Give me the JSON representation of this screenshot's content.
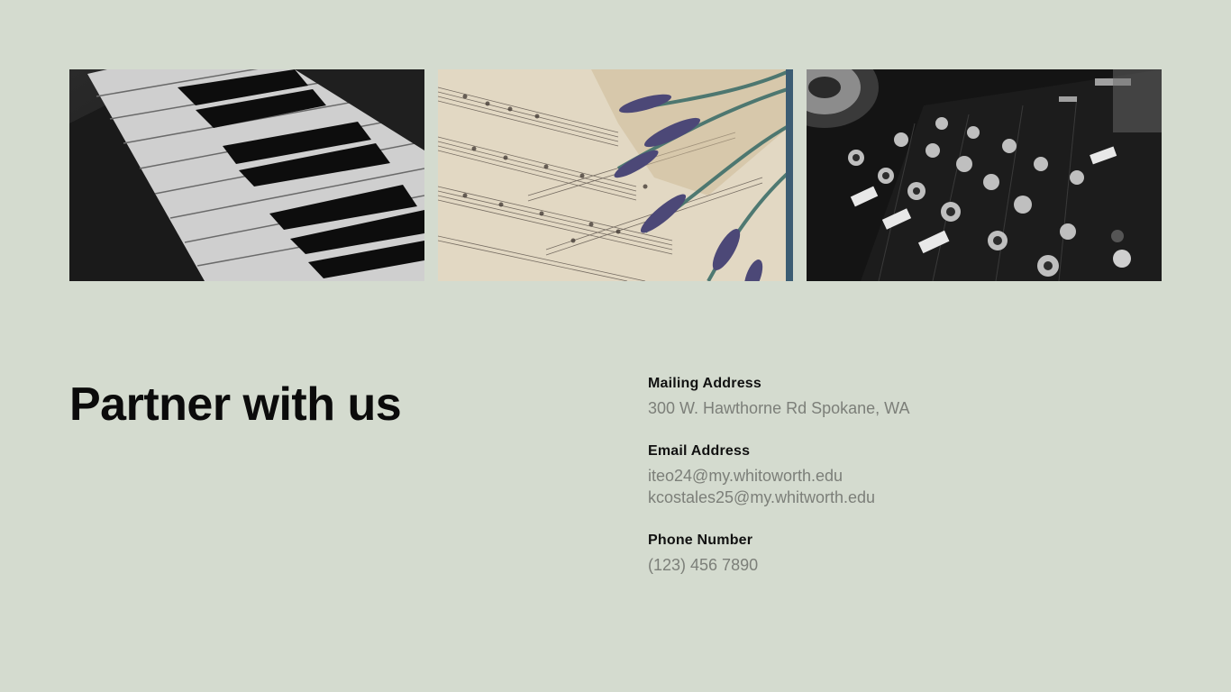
{
  "photos": [
    {
      "name": "piano-keys"
    },
    {
      "name": "sheet-music-lavender"
    },
    {
      "name": "dj-mixer"
    }
  ],
  "title": "Partner with us",
  "contact": {
    "mailing": {
      "label": "Mailing Address",
      "value": "300 W. Hawthorne Rd Spokane, WA"
    },
    "email": {
      "label": "Email Address",
      "values": [
        "iteo24@my.whitoworth.edu",
        "kcostales25@my.whitworth.edu"
      ]
    },
    "phone": {
      "label": "Phone Number",
      "value": "(123) 456 7890"
    }
  },
  "colors": {
    "background": "#d4dbcf",
    "title": "#0b0b0b",
    "label": "#111111",
    "value": "#7c7f79"
  }
}
